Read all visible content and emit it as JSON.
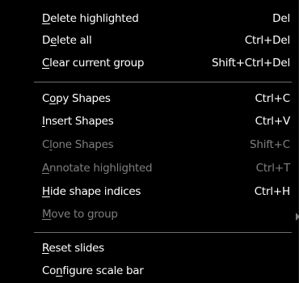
{
  "menu": {
    "items": [
      {
        "pre": "",
        "u": "D",
        "post": "elete highlighted",
        "shortcut": "Del",
        "disabled": false
      },
      {
        "pre": "D",
        "u": "e",
        "post": "lete all",
        "shortcut": "Ctrl+Del",
        "disabled": false
      },
      {
        "pre": "",
        "u": "C",
        "post": "lear current group",
        "shortcut": "Shift+Ctrl+Del",
        "disabled": false
      },
      {
        "pre": "C",
        "u": "o",
        "post": "py Shapes",
        "shortcut": "Ctrl+C",
        "disabled": false
      },
      {
        "pre": "",
        "u": "I",
        "post": "nsert Shapes",
        "shortcut": "Ctrl+V",
        "disabled": false
      },
      {
        "pre": "C",
        "u": "l",
        "post": "one Shapes",
        "shortcut": "Shift+C",
        "disabled": true
      },
      {
        "pre": "",
        "u": "A",
        "post": "nnotate highlighted",
        "shortcut": "Ctrl+T",
        "disabled": true
      },
      {
        "pre": "",
        "u": "H",
        "post": "ide shape indices",
        "shortcut": "Ctrl+H",
        "disabled": false
      },
      {
        "pre": "",
        "u": "M",
        "post": "ove to group",
        "shortcut": "",
        "disabled": true
      },
      {
        "pre": "",
        "u": "R",
        "post": "eset slides",
        "shortcut": "",
        "disabled": false
      },
      {
        "pre": "Co",
        "u": "n",
        "post": "figure scale bar",
        "shortcut": "",
        "disabled": false
      }
    ]
  },
  "colors": {
    "background": "#000000",
    "text": "#ffffff",
    "disabled_text": "#7f7f7f",
    "separator": "#6e6e6e"
  }
}
